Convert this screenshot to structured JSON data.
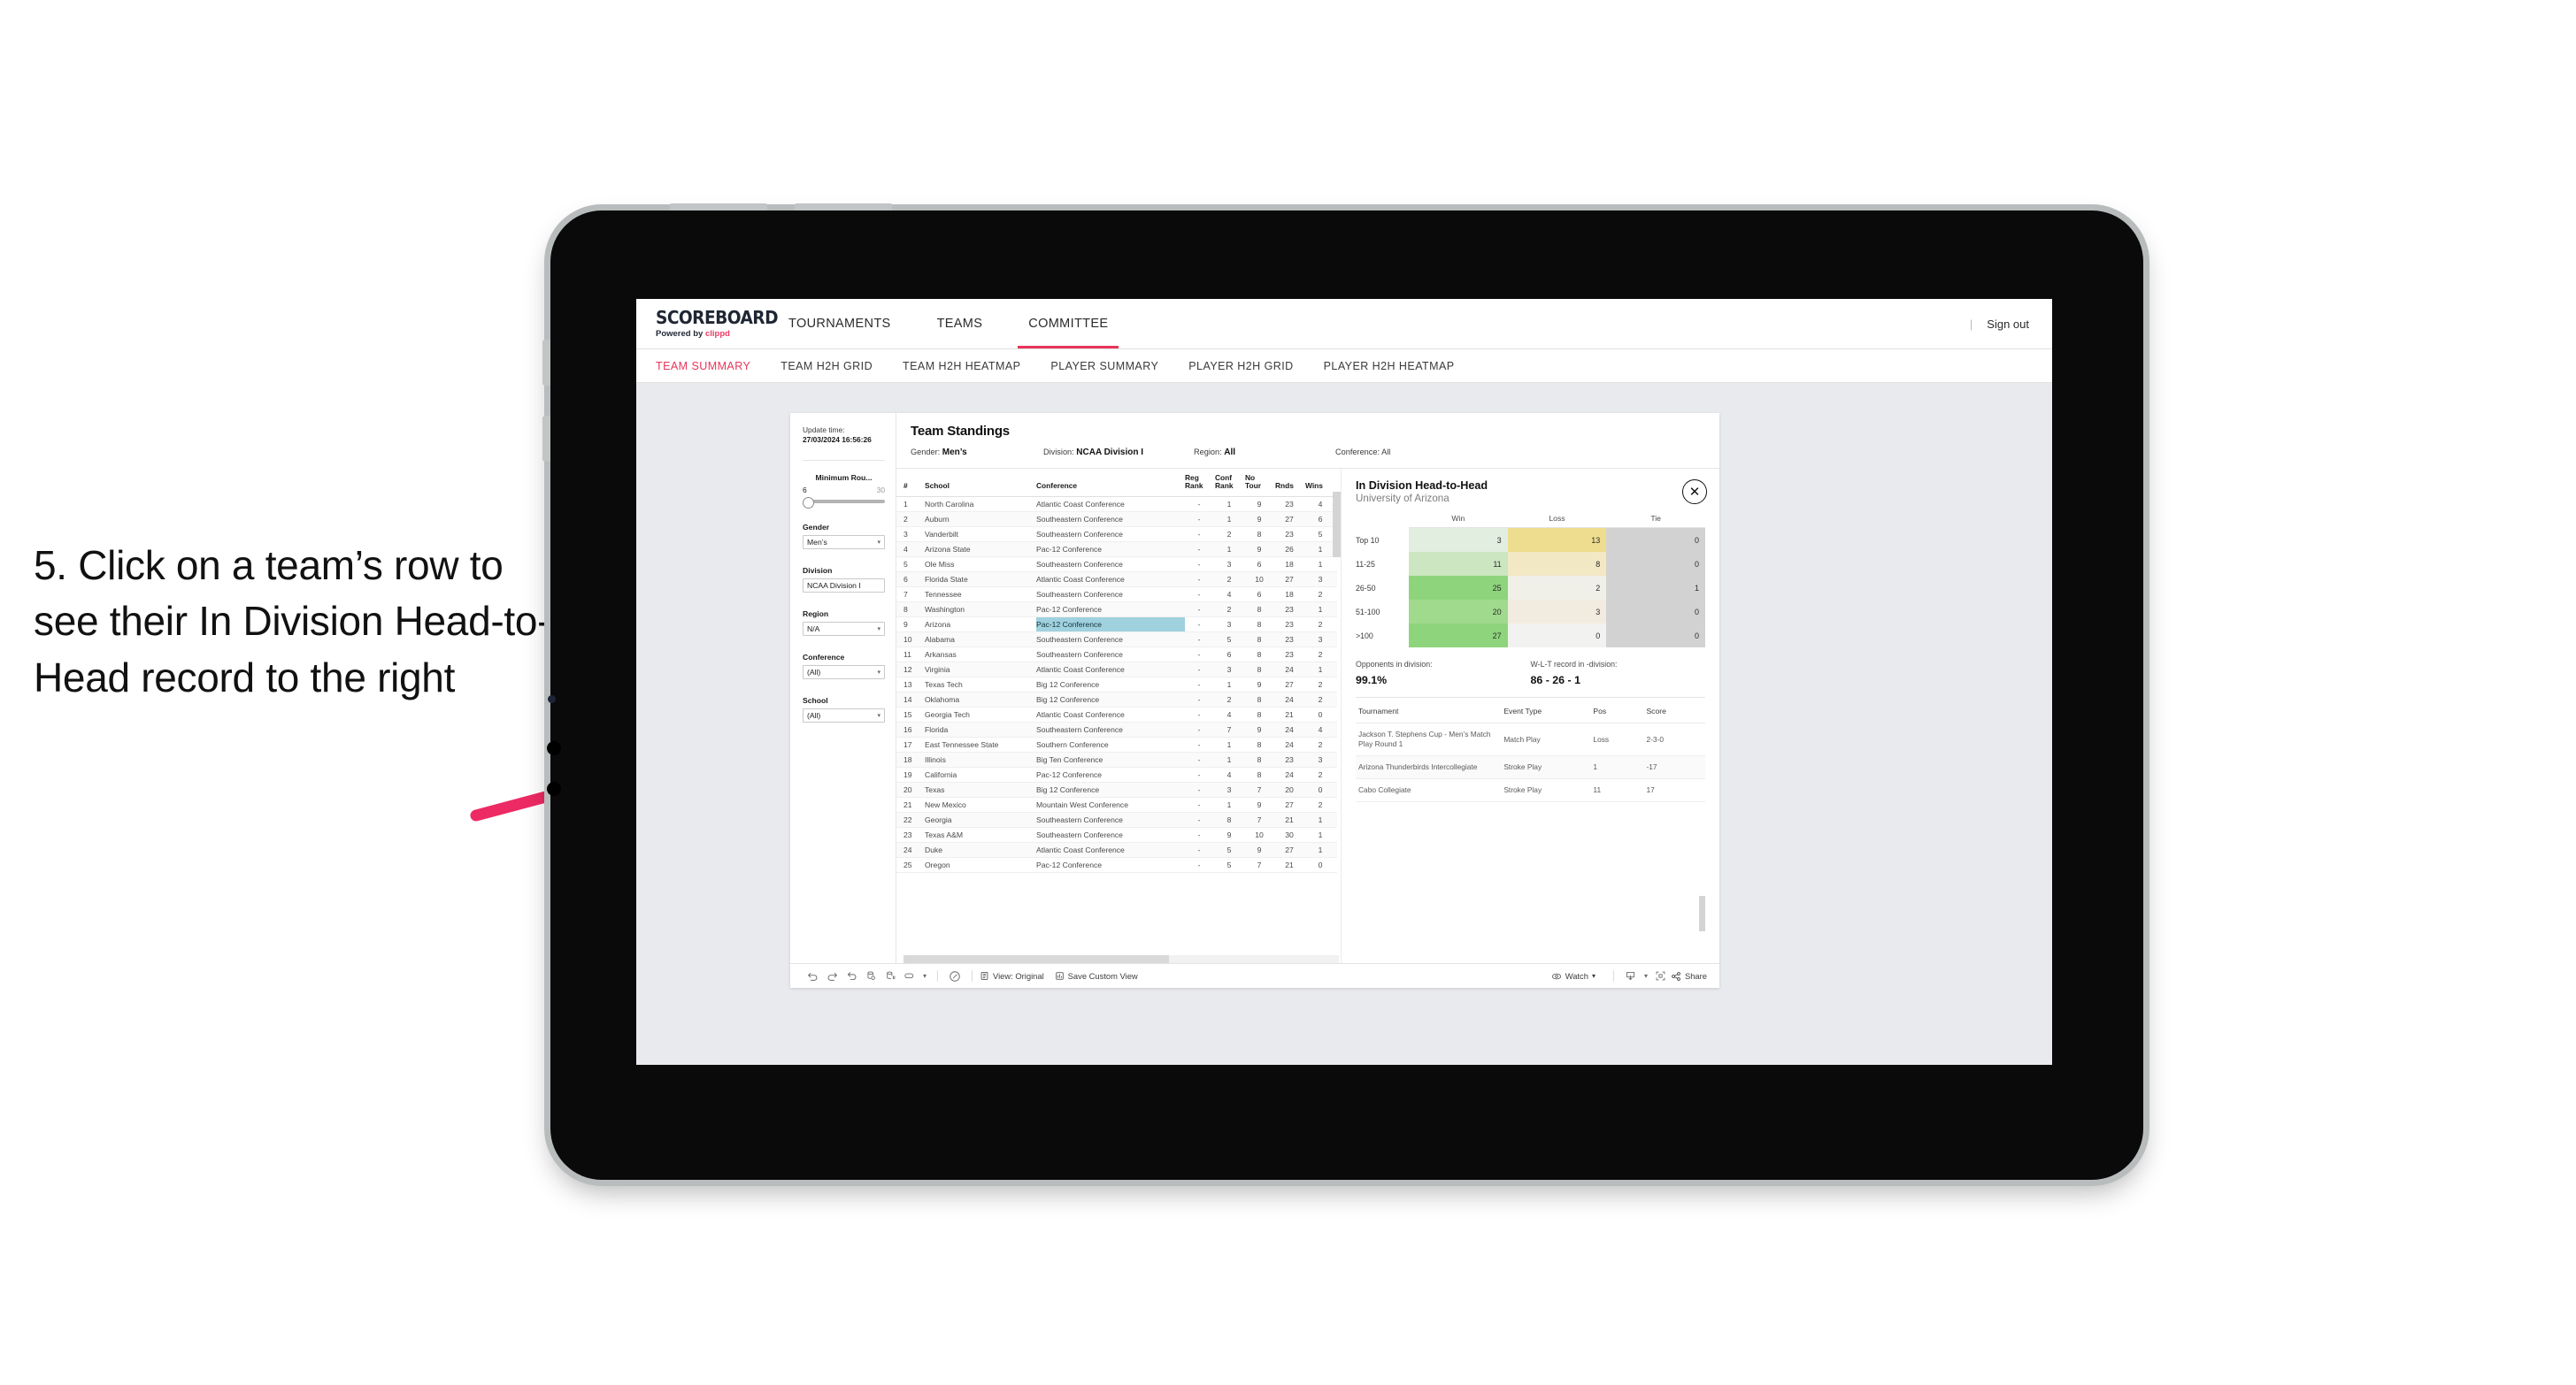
{
  "annotation": {
    "text": "5. Click on a team’s row to see their In Division Head-to-Head record to the right",
    "arrow_color": "#ed2a63"
  },
  "app": {
    "brand": {
      "name": "SCOREBOARD",
      "powered_prefix": "Powered by ",
      "powered_brand": "clippd"
    },
    "top_nav": [
      {
        "label": "TOURNAMENTS",
        "active": false
      },
      {
        "label": "TEAMS",
        "active": false
      },
      {
        "label": "COMMITTEE",
        "active": true
      }
    ],
    "sign_out": "Sign out",
    "sub_nav": [
      {
        "label": "TEAM SUMMARY",
        "active": true
      },
      {
        "label": "TEAM H2H GRID",
        "active": false
      },
      {
        "label": "TEAM H2H HEATMAP",
        "active": false
      },
      {
        "label": "PLAYER SUMMARY",
        "active": false
      },
      {
        "label": "PLAYER H2H GRID",
        "active": false
      },
      {
        "label": "PLAYER H2H HEATMAP",
        "active": false
      }
    ]
  },
  "filters": {
    "update_time_label": "Update time:",
    "update_time_value": "27/03/2024 16:56:26",
    "minimum_rounds": {
      "label": "Minimum Rou...",
      "min": "6",
      "max": "30"
    },
    "gender": {
      "label": "Gender",
      "value": "Men’s"
    },
    "division": {
      "label": "Division",
      "value": "NCAA Division I"
    },
    "region": {
      "label": "Region",
      "value": "N/A"
    },
    "conference": {
      "label": "Conference",
      "value": "(All)"
    },
    "school": {
      "label": "School",
      "value": "(All)"
    }
  },
  "standings": {
    "title": "Team Standings",
    "meta": [
      {
        "label": "Gender: ",
        "value": "Men’s"
      },
      {
        "label": "Division: ",
        "value": "NCAA Division I"
      },
      {
        "label": "Region: ",
        "value": "All"
      },
      {
        "label": "Conference: ",
        "value": "All"
      }
    ],
    "columns": [
      "#",
      "School",
      "Conference",
      "Reg Rank",
      "Conf Rank",
      "No Tour",
      "Rnds",
      "Wins"
    ],
    "column_heads": {
      "num": "#",
      "school": "School",
      "conference": "Conference",
      "reg1": "Reg",
      "reg2": "Rank",
      "conf1": "Conf",
      "conf2": "Rank",
      "not1": "No",
      "not2": "Tour",
      "rnds": "Rnds",
      "wins": "Wins"
    },
    "rows": [
      {
        "n": "1",
        "school": "North Carolina",
        "conf": "Atlantic Coast Conference",
        "reg": "-",
        "cr": "1",
        "nt": "9",
        "rnds": "23",
        "wins": "4",
        "selected": false
      },
      {
        "n": "2",
        "school": "Auburn",
        "conf": "Southeastern Conference",
        "reg": "-",
        "cr": "1",
        "nt": "9",
        "rnds": "27",
        "wins": "6",
        "selected": false
      },
      {
        "n": "3",
        "school": "Vanderbilt",
        "conf": "Southeastern Conference",
        "reg": "-",
        "cr": "2",
        "nt": "8",
        "rnds": "23",
        "wins": "5",
        "selected": false
      },
      {
        "n": "4",
        "school": "Arizona State",
        "conf": "Pac-12 Conference",
        "reg": "-",
        "cr": "1",
        "nt": "9",
        "rnds": "26",
        "wins": "1",
        "selected": false
      },
      {
        "n": "5",
        "school": "Ole Miss",
        "conf": "Southeastern Conference",
        "reg": "-",
        "cr": "3",
        "nt": "6",
        "rnds": "18",
        "wins": "1",
        "selected": false
      },
      {
        "n": "6",
        "school": "Florida State",
        "conf": "Atlantic Coast Conference",
        "reg": "-",
        "cr": "2",
        "nt": "10",
        "rnds": "27",
        "wins": "3",
        "selected": false
      },
      {
        "n": "7",
        "school": "Tennessee",
        "conf": "Southeastern Conference",
        "reg": "-",
        "cr": "4",
        "nt": "6",
        "rnds": "18",
        "wins": "2",
        "selected": false
      },
      {
        "n": "8",
        "school": "Washington",
        "conf": "Pac-12 Conference",
        "reg": "-",
        "cr": "2",
        "nt": "8",
        "rnds": "23",
        "wins": "1",
        "selected": false
      },
      {
        "n": "9",
        "school": "Arizona",
        "conf": "Pac-12 Conference",
        "reg": "-",
        "cr": "3",
        "nt": "8",
        "rnds": "23",
        "wins": "2",
        "selected": true
      },
      {
        "n": "10",
        "school": "Alabama",
        "conf": "Southeastern Conference",
        "reg": "-",
        "cr": "5",
        "nt": "8",
        "rnds": "23",
        "wins": "3",
        "selected": false
      },
      {
        "n": "11",
        "school": "Arkansas",
        "conf": "Southeastern Conference",
        "reg": "-",
        "cr": "6",
        "nt": "8",
        "rnds": "23",
        "wins": "2",
        "selected": false
      },
      {
        "n": "12",
        "school": "Virginia",
        "conf": "Atlantic Coast Conference",
        "reg": "-",
        "cr": "3",
        "nt": "8",
        "rnds": "24",
        "wins": "1",
        "selected": false
      },
      {
        "n": "13",
        "school": "Texas Tech",
        "conf": "Big 12 Conference",
        "reg": "-",
        "cr": "1",
        "nt": "9",
        "rnds": "27",
        "wins": "2",
        "selected": false
      },
      {
        "n": "14",
        "school": "Oklahoma",
        "conf": "Big 12 Conference",
        "reg": "-",
        "cr": "2",
        "nt": "8",
        "rnds": "24",
        "wins": "2",
        "selected": false
      },
      {
        "n": "15",
        "school": "Georgia Tech",
        "conf": "Atlantic Coast Conference",
        "reg": "-",
        "cr": "4",
        "nt": "8",
        "rnds": "21",
        "wins": "0",
        "selected": false
      },
      {
        "n": "16",
        "school": "Florida",
        "conf": "Southeastern Conference",
        "reg": "-",
        "cr": "7",
        "nt": "9",
        "rnds": "24",
        "wins": "4",
        "selected": false
      },
      {
        "n": "17",
        "school": "East Tennessee State",
        "conf": "Southern Conference",
        "reg": "-",
        "cr": "1",
        "nt": "8",
        "rnds": "24",
        "wins": "2",
        "selected": false
      },
      {
        "n": "18",
        "school": "Illinois",
        "conf": "Big Ten Conference",
        "reg": "-",
        "cr": "1",
        "nt": "8",
        "rnds": "23",
        "wins": "3",
        "selected": false
      },
      {
        "n": "19",
        "school": "California",
        "conf": "Pac-12 Conference",
        "reg": "-",
        "cr": "4",
        "nt": "8",
        "rnds": "24",
        "wins": "2",
        "selected": false
      },
      {
        "n": "20",
        "school": "Texas",
        "conf": "Big 12 Conference",
        "reg": "-",
        "cr": "3",
        "nt": "7",
        "rnds": "20",
        "wins": "0",
        "selected": false
      },
      {
        "n": "21",
        "school": "New Mexico",
        "conf": "Mountain West Conference",
        "reg": "-",
        "cr": "1",
        "nt": "9",
        "rnds": "27",
        "wins": "2",
        "selected": false
      },
      {
        "n": "22",
        "school": "Georgia",
        "conf": "Southeastern Conference",
        "reg": "-",
        "cr": "8",
        "nt": "7",
        "rnds": "21",
        "wins": "1",
        "selected": false
      },
      {
        "n": "23",
        "school": "Texas A&M",
        "conf": "Southeastern Conference",
        "reg": "-",
        "cr": "9",
        "nt": "10",
        "rnds": "30",
        "wins": "1",
        "selected": false
      },
      {
        "n": "24",
        "school": "Duke",
        "conf": "Atlantic Coast Conference",
        "reg": "-",
        "cr": "5",
        "nt": "9",
        "rnds": "27",
        "wins": "1",
        "selected": false
      },
      {
        "n": "25",
        "school": "Oregon",
        "conf": "Pac-12 Conference",
        "reg": "-",
        "cr": "5",
        "nt": "7",
        "rnds": "21",
        "wins": "0",
        "selected": false
      }
    ]
  },
  "detail": {
    "title": "In Division Head-to-Head",
    "subtitle": "University of Arizona",
    "close_icon": "close-icon",
    "chart_data": {
      "type": "heatmap",
      "title": "In Division Head-to-Head",
      "subtitle": "University of Arizona",
      "columns": [
        "Win",
        "Loss",
        "Tie"
      ],
      "rows": [
        "Top 10",
        "11-25",
        "26-50",
        "51-100",
        ">100"
      ],
      "values": [
        [
          3,
          13,
          0
        ],
        [
          11,
          8,
          0
        ],
        [
          25,
          2,
          1
        ],
        [
          20,
          3,
          0
        ],
        [
          27,
          0,
          0
        ]
      ],
      "cell_colors": [
        [
          "#e2eee0",
          "#eedd8f",
          "#d2d2d2"
        ],
        [
          "#cbe6c0",
          "#f2e8c4",
          "#d2d2d2"
        ],
        [
          "#8ed47c",
          "#f0efe8",
          "#d2d2d2"
        ],
        [
          "#a0da8c",
          "#f2ece0",
          "#d2d2d2"
        ],
        [
          "#8ed47c",
          "#f2f2f0",
          "#d2d2d2"
        ]
      ]
    },
    "stats": [
      {
        "label": "Opponents in division:",
        "value": "99.1%"
      },
      {
        "label": "W-L-T record in -division:",
        "value": "86 - 26 - 1"
      }
    ],
    "tournaments": {
      "columns": [
        "Tournament",
        "Event Type",
        "Pos",
        "Score"
      ],
      "rows": [
        {
          "name": "Jackson T. Stephens Cup - Men’s Match Play Round 1",
          "type": "Match Play",
          "pos": "Loss",
          "score": "2-3-0"
        },
        {
          "name": "Arizona Thunderbirds Intercollegiate",
          "type": "Stroke Play",
          "pos": "1",
          "score": "-17"
        },
        {
          "name": "Cabo Collegiate",
          "type": "Stroke Play",
          "pos": "11",
          "score": "17"
        }
      ]
    }
  },
  "toolbar": {
    "view_label": "View: Original",
    "save_label": "Save Custom View",
    "watch_label": "Watch",
    "share_label": "Share"
  }
}
